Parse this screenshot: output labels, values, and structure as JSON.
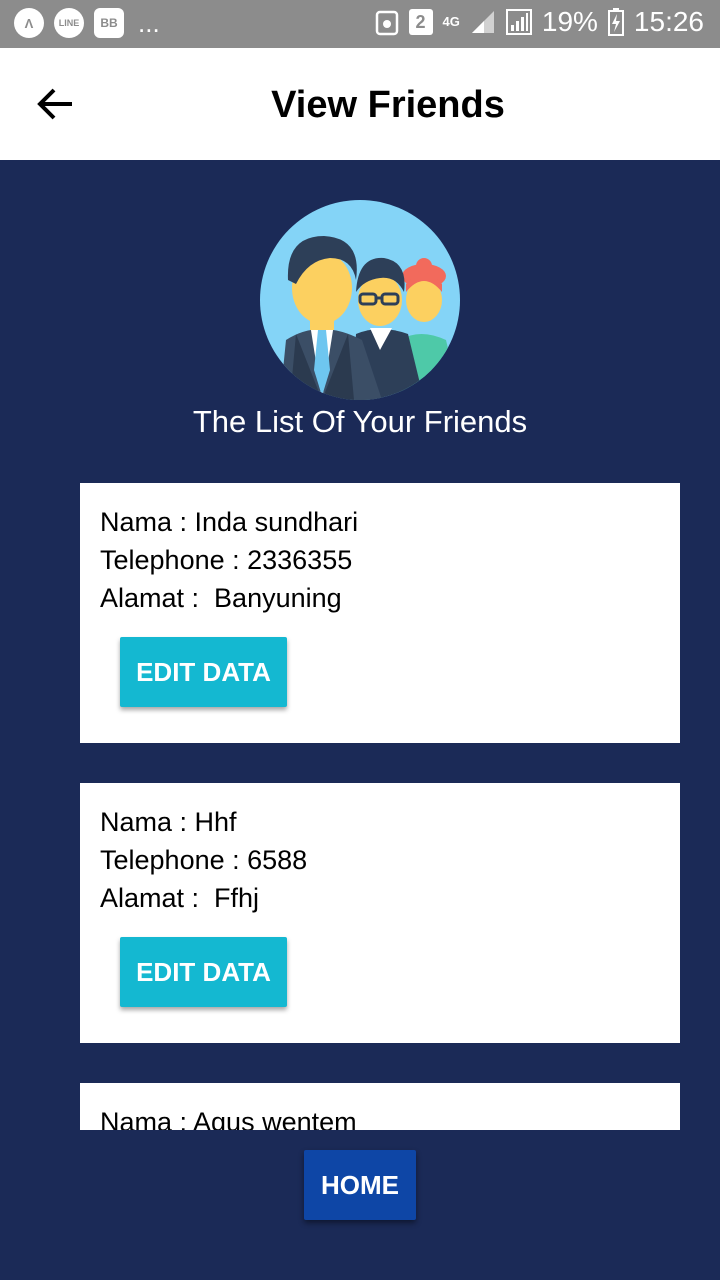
{
  "status_bar": {
    "app_icon_1": "Λ",
    "app_icon_2": "LINE",
    "app_icon_3": "BB",
    "more": "...",
    "sim_badge": "2",
    "network": "4G",
    "battery_percent": "19%",
    "time": "15:26"
  },
  "app_bar": {
    "title": "View Friends"
  },
  "header": {
    "heading": "The List Of Your Friends"
  },
  "friends": [
    {
      "nama": "Nama : Inda sundhari",
      "telephone": "Telephone : 2336355",
      "alamat": "Alamat :  Banyuning",
      "button_label": "EDIT DATA"
    },
    {
      "nama": "Nama : Hhf",
      "telephone": "Telephone : 6588",
      "alamat": "Alamat :  Ffhj",
      "button_label": "EDIT DATA"
    },
    {
      "nama": "Nama : Agus wentem"
    }
  ],
  "home_button": {
    "label": "HOME"
  },
  "colors": {
    "background": "#1b2a57",
    "edit_button": "#14b8d1",
    "home_button": "#0e46a6",
    "avatar_circle": "#84d4f7"
  }
}
